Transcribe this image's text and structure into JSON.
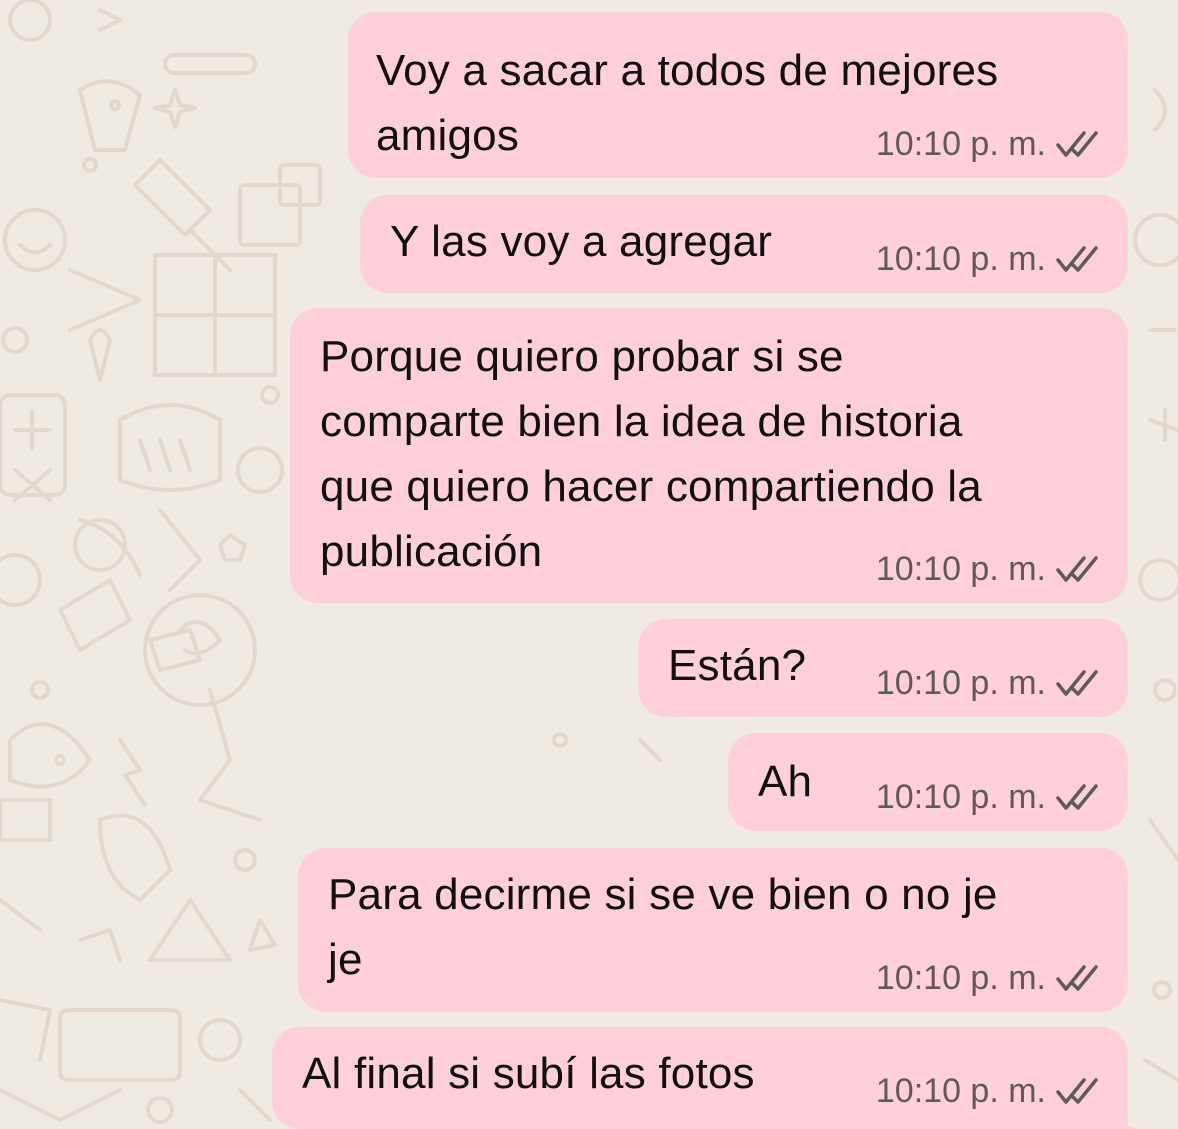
{
  "theme": {
    "bubble_color": "#ffcfda",
    "background_color": "#efeae2",
    "pattern_color": "#e2d9cc",
    "meta_color": "#5e5a5b",
    "text_color": "#111111"
  },
  "messages": [
    {
      "text": "Voy a sacar a todos de mejores\namigos",
      "time": "10:10 p. m.",
      "status_icon": "double-check-icon"
    },
    {
      "text": "Y las voy a agregar",
      "time": "10:10 p. m.",
      "status_icon": "double-check-icon"
    },
    {
      "text": "Porque quiero probar si se\ncomparte bien la idea de historia\nque quiero hacer compartiendo la\npublicación",
      "time": "10:10 p. m.",
      "status_icon": "double-check-icon"
    },
    {
      "text": "Están?",
      "time": "10:10 p. m.",
      "status_icon": "double-check-icon"
    },
    {
      "text": "Ah",
      "time": "10:10 p. m.",
      "status_icon": "double-check-icon"
    },
    {
      "text": "Para decirme si se ve bien o no je\nje",
      "time": "10:10 p. m.",
      "status_icon": "double-check-icon"
    },
    {
      "text": "Al final si subí las fotos",
      "time": "10:10 p. m.",
      "status_icon": "double-check-icon"
    }
  ]
}
